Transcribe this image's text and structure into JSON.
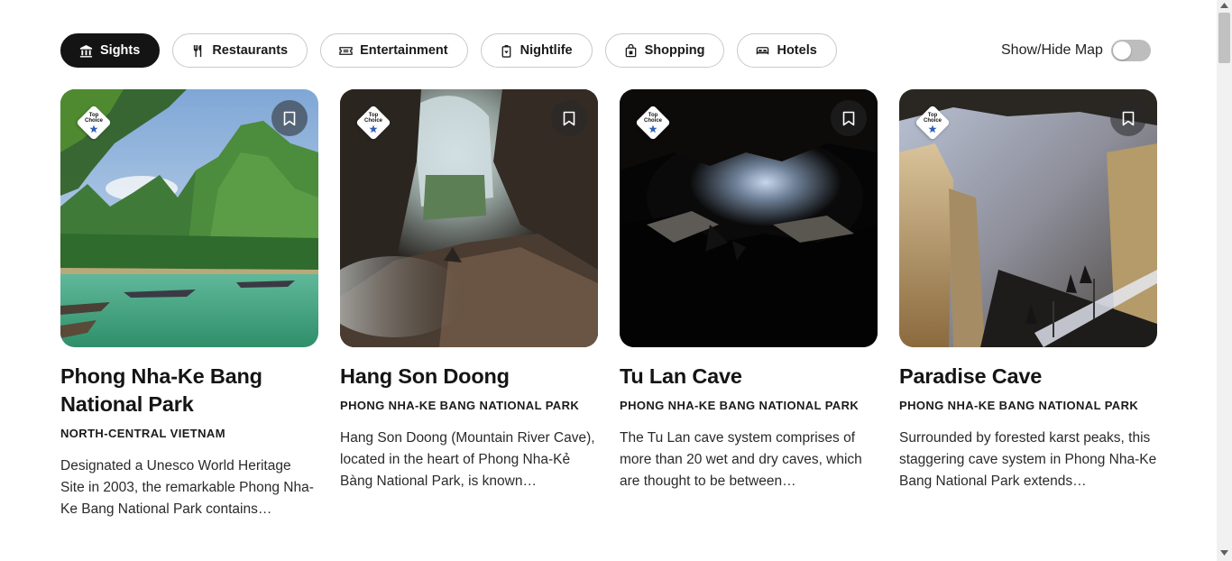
{
  "filters": [
    {
      "label": "Sights",
      "icon": "landmark-icon",
      "active": true
    },
    {
      "label": "Restaurants",
      "icon": "fork-knife-icon",
      "active": false
    },
    {
      "label": "Entertainment",
      "icon": "ticket-icon",
      "active": false
    },
    {
      "label": "Nightlife",
      "icon": "cocktail-icon",
      "active": false
    },
    {
      "label": "Shopping",
      "icon": "shopping-bag-icon",
      "active": false
    },
    {
      "label": "Hotels",
      "icon": "bed-icon",
      "active": false
    }
  ],
  "map_toggle": {
    "label": "Show/Hide Map",
    "on": false
  },
  "badge": {
    "line1": "Top",
    "line2": "Choice"
  },
  "cards": [
    {
      "title": "Phong Nha-Ke Bang National Park",
      "region": "NORTH-CENTRAL VIETNAM",
      "description": "Designated a Unesco World Heritage Site in 2003, the remarkable Phong Nha-Ke Bang National Park contains…",
      "image": "karst-river-landscape"
    },
    {
      "title": "Hang Son Doong",
      "region": "PHONG NHA-KE BANG NATIONAL PARK",
      "description": "Hang Son Doong (Mountain River Cave), located in the heart of Phong Nha-Kẻ Bàng National Park, is known…",
      "image": "cave-skylight"
    },
    {
      "title": "Tu Lan Cave",
      "region": "PHONG NHA-KE BANG NATIONAL PARK",
      "description": "The Tu Lan cave system comprises of more than 20 wet and dry caves, which are thought to be between…",
      "image": "dark-cave-opening"
    },
    {
      "title": "Paradise Cave",
      "region": "PHONG NHA-KE BANG NATIONAL PARK",
      "description": "Surrounded by forested karst peaks, this staggering cave system in Phong Nha-Ke Bang National Park extends…",
      "image": "lit-cave-walkway"
    }
  ],
  "colors": {
    "active_chip": "#141414",
    "badge_star": "#2f5fb3",
    "toggle_off": "#bdbdbd"
  }
}
